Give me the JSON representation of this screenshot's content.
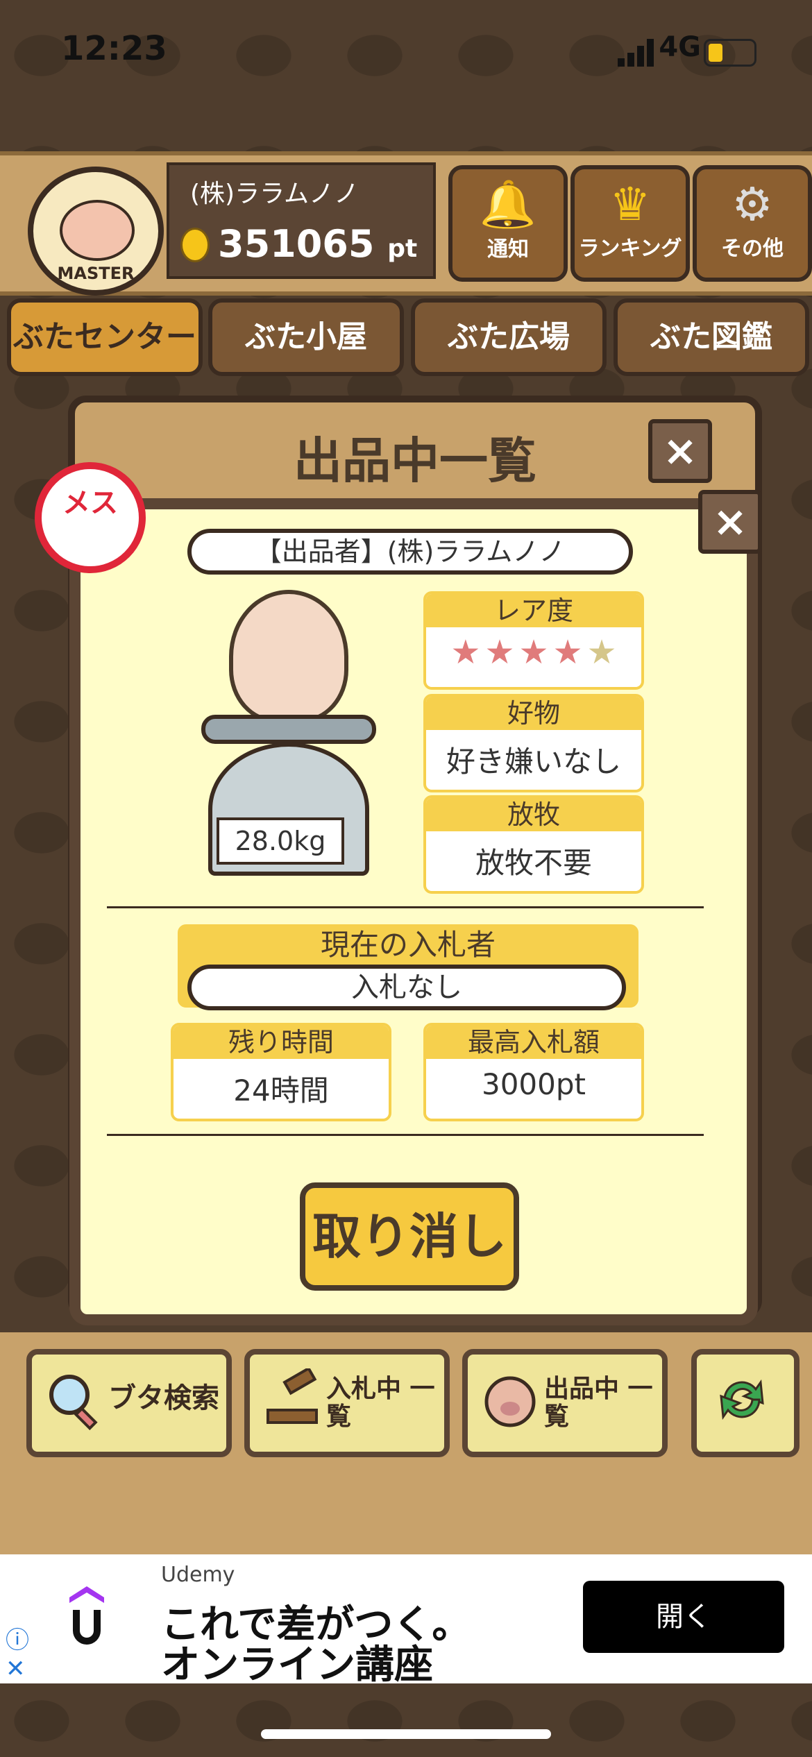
{
  "status": {
    "time": "12:23",
    "network": "4G"
  },
  "header": {
    "master_label": "MASTER",
    "username": "(株)ララムノノ",
    "points": "351065",
    "points_unit": "pt",
    "buttons": [
      "通知",
      "ランキング",
      "その他"
    ]
  },
  "tabs": [
    "ぶたセンター",
    "ぶた小屋",
    "ぶた広場",
    "ぶた図鑑"
  ],
  "modal": {
    "title": "出品中一覧",
    "close": "×"
  },
  "detail": {
    "gender": "メス",
    "close": "×",
    "seller": "【出品者】(株)ララムノノ",
    "weight": "28.0kg",
    "rarity_label": "レア度",
    "rarity_stars": 4,
    "rarity_max": 5,
    "favorite_label": "好物",
    "favorite_value": "好き嫌いなし",
    "grazing_label": "放牧",
    "grazing_value": "放牧不要",
    "bidder_label": "現在の入札者",
    "bidder_value": "入札なし",
    "remaining_label": "残り時間",
    "remaining_value": "24時間",
    "highest_label": "最高入札額",
    "highest_value": "3000pt",
    "cancel_label": "取り消し"
  },
  "bottom": {
    "search": "ブタ検索",
    "bidding": "入札中 一覧",
    "listing": "出品中 一覧"
  },
  "ad": {
    "brand": "Udemy",
    "line1": "これで差がつく。",
    "line2": "オンライン講座",
    "button": "開く"
  }
}
